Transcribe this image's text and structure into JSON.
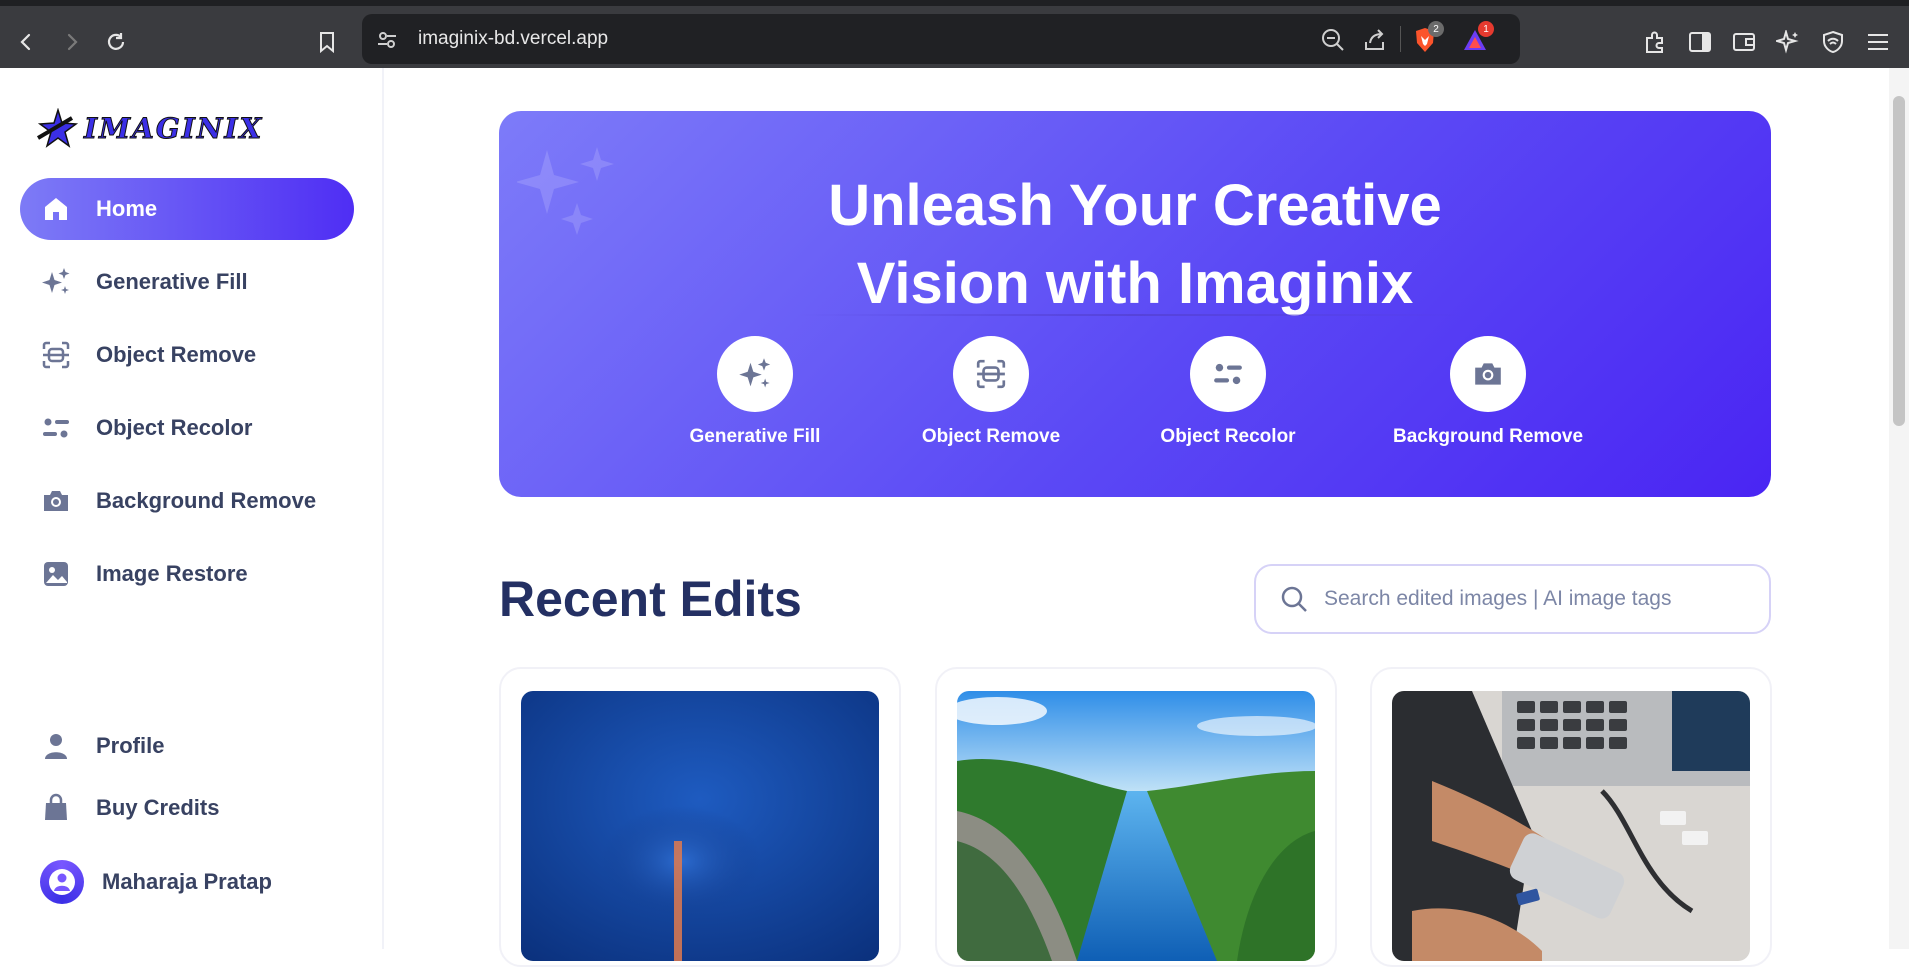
{
  "browser": {
    "url": "imaginix-bd.vercel.app",
    "brave_badge": "2",
    "alert_badge": "1"
  },
  "sidebar": {
    "logo_text": "IMAGINIX",
    "items": [
      {
        "label": "Home",
        "icon": "home-icon"
      },
      {
        "label": "Generative Fill",
        "icon": "sparkles-icon"
      },
      {
        "label": "Object Remove",
        "icon": "scan-icon"
      },
      {
        "label": "Object Recolor",
        "icon": "filter-icon"
      },
      {
        "label": "Background Remove",
        "icon": "camera-icon"
      },
      {
        "label": "Image Restore",
        "icon": "image-icon"
      }
    ],
    "bottom_items": [
      {
        "label": "Profile",
        "icon": "user-icon"
      },
      {
        "label": "Buy Credits",
        "icon": "bag-icon"
      }
    ],
    "user_name": "Maharaja Pratap"
  },
  "hero": {
    "title_line1": "Unleash Your Creative",
    "title_line2": "Vision with Imaginix",
    "tools": [
      {
        "label": "Generative Fill",
        "icon": "sparkles-icon"
      },
      {
        "label": "Object Remove",
        "icon": "scan-icon"
      },
      {
        "label": "Object Recolor",
        "icon": "filter-icon"
      },
      {
        "label": "Background Remove",
        "icon": "camera-icon"
      }
    ]
  },
  "recent": {
    "title": "Recent Edits",
    "search_placeholder": "Search edited images | AI image tags"
  },
  "colors": {
    "accent": "#4f2ef4",
    "sidebar_text": "#384262",
    "heading": "#243063"
  }
}
